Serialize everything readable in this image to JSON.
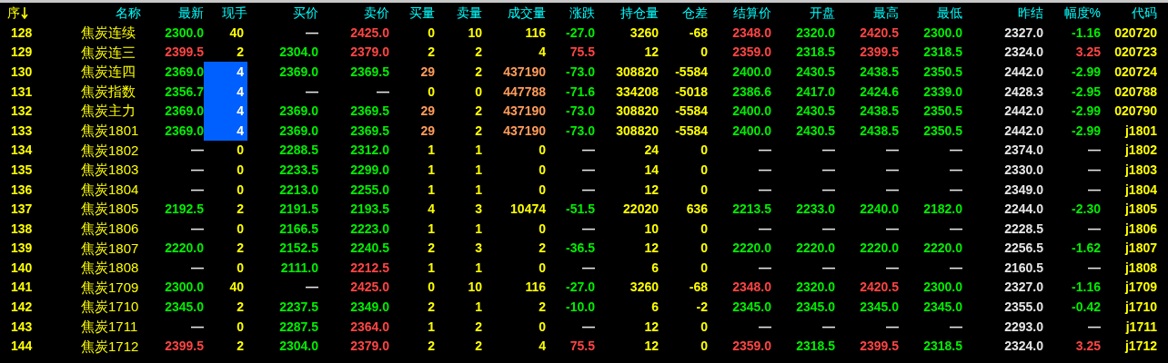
{
  "columns": [
    {
      "label": "序",
      "sort_descending": true
    },
    {
      "label": "名称"
    },
    {
      "label": "最新"
    },
    {
      "label": "现手"
    },
    {
      "label": "买价"
    },
    {
      "label": "卖价"
    },
    {
      "label": "买量"
    },
    {
      "label": "卖量"
    },
    {
      "label": "成交量"
    },
    {
      "label": "涨跌"
    },
    {
      "label": "持仓量"
    },
    {
      "label": "仓差"
    },
    {
      "label": "结算价"
    },
    {
      "label": "开盘"
    },
    {
      "label": "最高"
    },
    {
      "label": "最低"
    },
    {
      "label": "昨结"
    },
    {
      "label": "幅度%"
    },
    {
      "label": "代码"
    }
  ],
  "rows": [
    {
      "volume_highlighted": false,
      "cells": [
        {
          "text": "128",
          "color": "#ffff00"
        },
        {
          "text": "焦炭连续",
          "color": "#ffff00"
        },
        {
          "text": "2300.0",
          "color": "#00ee00"
        },
        {
          "text": "40",
          "color": "#ffff00"
        },
        {
          "text": "—",
          "color": "#e6e6e6"
        },
        {
          "text": "2425.0",
          "color": "#ff4444"
        },
        {
          "text": "0",
          "color": "#ffff00"
        },
        {
          "text": "10",
          "color": "#ffff00"
        },
        {
          "text": "116",
          "color": "#ffff00"
        },
        {
          "text": "-27.0",
          "color": "#00ee00"
        },
        {
          "text": "3260",
          "color": "#ffff00"
        },
        {
          "text": "-68",
          "color": "#ffff00"
        },
        {
          "text": "2348.0",
          "color": "#ff4444"
        },
        {
          "text": "2320.0",
          "color": "#00ee00"
        },
        {
          "text": "2420.5",
          "color": "#ff4444"
        },
        {
          "text": "2300.0",
          "color": "#00ee00"
        },
        {
          "text": "2327.0",
          "color": "#e6e6e6"
        },
        {
          "text": "-1.16",
          "color": "#00ee00"
        },
        {
          "text": "020720",
          "color": "#ffff00"
        }
      ]
    },
    {
      "volume_highlighted": false,
      "cells": [
        {
          "text": "129",
          "color": "#ffff00"
        },
        {
          "text": "焦炭连三",
          "color": "#ffff00"
        },
        {
          "text": "2399.5",
          "color": "#ff4444"
        },
        {
          "text": "2",
          "color": "#ffff00"
        },
        {
          "text": "2304.0",
          "color": "#00ee00"
        },
        {
          "text": "2379.0",
          "color": "#ff4444"
        },
        {
          "text": "2",
          "color": "#ffff00"
        },
        {
          "text": "2",
          "color": "#ffff00"
        },
        {
          "text": "4",
          "color": "#ffff00"
        },
        {
          "text": "75.5",
          "color": "#ff4444"
        },
        {
          "text": "12",
          "color": "#ffff00"
        },
        {
          "text": "0",
          "color": "#ffff00"
        },
        {
          "text": "2359.0",
          "color": "#ff4444"
        },
        {
          "text": "2318.5",
          "color": "#00ee00"
        },
        {
          "text": "2399.5",
          "color": "#ff4444"
        },
        {
          "text": "2318.5",
          "color": "#00ee00"
        },
        {
          "text": "2324.0",
          "color": "#e6e6e6"
        },
        {
          "text": "3.25",
          "color": "#ff4444"
        },
        {
          "text": "020723",
          "color": "#ffff00"
        }
      ]
    },
    {
      "volume_highlighted": true,
      "cells": [
        {
          "text": "130",
          "color": "#ffff00"
        },
        {
          "text": "焦炭连四",
          "color": "#ffff00"
        },
        {
          "text": "2369.0",
          "color": "#00ee00"
        },
        {
          "text": "4",
          "color": "#ffffff"
        },
        {
          "text": "2369.0",
          "color": "#00ee00"
        },
        {
          "text": "2369.5",
          "color": "#00ee00"
        },
        {
          "text": "29",
          "color": "#ff9c5a"
        },
        {
          "text": "2",
          "color": "#ffff00"
        },
        {
          "text": "437190",
          "color": "#ff9c5a"
        },
        {
          "text": "-73.0",
          "color": "#00ee00"
        },
        {
          "text": "308820",
          "color": "#ffff00"
        },
        {
          "text": "-5584",
          "color": "#ffff00"
        },
        {
          "text": "2400.0",
          "color": "#00ee00"
        },
        {
          "text": "2430.5",
          "color": "#00ee00"
        },
        {
          "text": "2438.5",
          "color": "#00ee00"
        },
        {
          "text": "2350.5",
          "color": "#00ee00"
        },
        {
          "text": "2442.0",
          "color": "#e6e6e6"
        },
        {
          "text": "-2.99",
          "color": "#00ee00"
        },
        {
          "text": "020724",
          "color": "#ffff00"
        }
      ]
    },
    {
      "volume_highlighted": true,
      "cells": [
        {
          "text": "131",
          "color": "#ffff00"
        },
        {
          "text": "焦炭指数",
          "color": "#ffff00"
        },
        {
          "text": "2356.7",
          "color": "#00ee00"
        },
        {
          "text": "4",
          "color": "#ffffff"
        },
        {
          "text": "—",
          "color": "#e6e6e6"
        },
        {
          "text": "—",
          "color": "#e6e6e6"
        },
        {
          "text": "0",
          "color": "#ffff00"
        },
        {
          "text": "0",
          "color": "#ffff00"
        },
        {
          "text": "447788",
          "color": "#ff9c5a"
        },
        {
          "text": "-71.6",
          "color": "#00ee00"
        },
        {
          "text": "334208",
          "color": "#ffff00"
        },
        {
          "text": "-5018",
          "color": "#ffff00"
        },
        {
          "text": "2386.6",
          "color": "#00ee00"
        },
        {
          "text": "2417.0",
          "color": "#00ee00"
        },
        {
          "text": "2424.6",
          "color": "#00ee00"
        },
        {
          "text": "2339.0",
          "color": "#00ee00"
        },
        {
          "text": "2428.3",
          "color": "#e6e6e6"
        },
        {
          "text": "-2.95",
          "color": "#00ee00"
        },
        {
          "text": "020788",
          "color": "#ffff00"
        }
      ]
    },
    {
      "volume_highlighted": true,
      "cells": [
        {
          "text": "132",
          "color": "#ffff00"
        },
        {
          "text": "焦炭主力",
          "color": "#ffff00"
        },
        {
          "text": "2369.0",
          "color": "#00ee00"
        },
        {
          "text": "4",
          "color": "#ffffff"
        },
        {
          "text": "2369.0",
          "color": "#00ee00"
        },
        {
          "text": "2369.5",
          "color": "#00ee00"
        },
        {
          "text": "29",
          "color": "#ff9c5a"
        },
        {
          "text": "2",
          "color": "#ffff00"
        },
        {
          "text": "437190",
          "color": "#ff9c5a"
        },
        {
          "text": "-73.0",
          "color": "#00ee00"
        },
        {
          "text": "308820",
          "color": "#ffff00"
        },
        {
          "text": "-5584",
          "color": "#ffff00"
        },
        {
          "text": "2400.0",
          "color": "#00ee00"
        },
        {
          "text": "2430.5",
          "color": "#00ee00"
        },
        {
          "text": "2438.5",
          "color": "#00ee00"
        },
        {
          "text": "2350.5",
          "color": "#00ee00"
        },
        {
          "text": "2442.0",
          "color": "#e6e6e6"
        },
        {
          "text": "-2.99",
          "color": "#00ee00"
        },
        {
          "text": "020790",
          "color": "#ffff00"
        }
      ]
    },
    {
      "volume_highlighted": true,
      "cells": [
        {
          "text": "133",
          "color": "#ffff00"
        },
        {
          "text": "焦炭1801",
          "color": "#ffff00"
        },
        {
          "text": "2369.0",
          "color": "#00ee00"
        },
        {
          "text": "4",
          "color": "#ffffff"
        },
        {
          "text": "2369.0",
          "color": "#00ee00"
        },
        {
          "text": "2369.5",
          "color": "#00ee00"
        },
        {
          "text": "29",
          "color": "#ff9c5a"
        },
        {
          "text": "2",
          "color": "#ffff00"
        },
        {
          "text": "437190",
          "color": "#ff9c5a"
        },
        {
          "text": "-73.0",
          "color": "#00ee00"
        },
        {
          "text": "308820",
          "color": "#ffff00"
        },
        {
          "text": "-5584",
          "color": "#ffff00"
        },
        {
          "text": "2400.0",
          "color": "#00ee00"
        },
        {
          "text": "2430.5",
          "color": "#00ee00"
        },
        {
          "text": "2438.5",
          "color": "#00ee00"
        },
        {
          "text": "2350.5",
          "color": "#00ee00"
        },
        {
          "text": "2442.0",
          "color": "#e6e6e6"
        },
        {
          "text": "-2.99",
          "color": "#00ee00"
        },
        {
          "text": "j1801",
          "color": "#ffff00"
        }
      ]
    },
    {
      "volume_highlighted": false,
      "cells": [
        {
          "text": "134",
          "color": "#ffff00"
        },
        {
          "text": "焦炭1802",
          "color": "#ffff00"
        },
        {
          "text": "—",
          "color": "#e6e6e6"
        },
        {
          "text": "0",
          "color": "#ffff00"
        },
        {
          "text": "2288.5",
          "color": "#00ee00"
        },
        {
          "text": "2312.0",
          "color": "#00ee00"
        },
        {
          "text": "1",
          "color": "#ffff00"
        },
        {
          "text": "1",
          "color": "#ffff00"
        },
        {
          "text": "0",
          "color": "#ffff00"
        },
        {
          "text": "—",
          "color": "#e6e6e6"
        },
        {
          "text": "24",
          "color": "#ffff00"
        },
        {
          "text": "0",
          "color": "#ffff00"
        },
        {
          "text": "—",
          "color": "#e6e6e6"
        },
        {
          "text": "—",
          "color": "#e6e6e6"
        },
        {
          "text": "—",
          "color": "#e6e6e6"
        },
        {
          "text": "—",
          "color": "#e6e6e6"
        },
        {
          "text": "2374.0",
          "color": "#e6e6e6"
        },
        {
          "text": "—",
          "color": "#e6e6e6"
        },
        {
          "text": "j1802",
          "color": "#ffff00"
        }
      ]
    },
    {
      "volume_highlighted": false,
      "cells": [
        {
          "text": "135",
          "color": "#ffff00"
        },
        {
          "text": "焦炭1803",
          "color": "#ffff00"
        },
        {
          "text": "—",
          "color": "#e6e6e6"
        },
        {
          "text": "0",
          "color": "#ffff00"
        },
        {
          "text": "2233.5",
          "color": "#00ee00"
        },
        {
          "text": "2299.0",
          "color": "#00ee00"
        },
        {
          "text": "1",
          "color": "#ffff00"
        },
        {
          "text": "1",
          "color": "#ffff00"
        },
        {
          "text": "0",
          "color": "#ffff00"
        },
        {
          "text": "—",
          "color": "#e6e6e6"
        },
        {
          "text": "14",
          "color": "#ffff00"
        },
        {
          "text": "0",
          "color": "#ffff00"
        },
        {
          "text": "—",
          "color": "#e6e6e6"
        },
        {
          "text": "—",
          "color": "#e6e6e6"
        },
        {
          "text": "—",
          "color": "#e6e6e6"
        },
        {
          "text": "—",
          "color": "#e6e6e6"
        },
        {
          "text": "2330.0",
          "color": "#e6e6e6"
        },
        {
          "text": "—",
          "color": "#e6e6e6"
        },
        {
          "text": "j1803",
          "color": "#ffff00"
        }
      ]
    },
    {
      "volume_highlighted": false,
      "cells": [
        {
          "text": "136",
          "color": "#ffff00"
        },
        {
          "text": "焦炭1804",
          "color": "#ffff00"
        },
        {
          "text": "—",
          "color": "#e6e6e6"
        },
        {
          "text": "0",
          "color": "#ffff00"
        },
        {
          "text": "2213.0",
          "color": "#00ee00"
        },
        {
          "text": "2255.0",
          "color": "#00ee00"
        },
        {
          "text": "1",
          "color": "#ffff00"
        },
        {
          "text": "1",
          "color": "#ffff00"
        },
        {
          "text": "0",
          "color": "#ffff00"
        },
        {
          "text": "—",
          "color": "#e6e6e6"
        },
        {
          "text": "12",
          "color": "#ffff00"
        },
        {
          "text": "0",
          "color": "#ffff00"
        },
        {
          "text": "—",
          "color": "#e6e6e6"
        },
        {
          "text": "—",
          "color": "#e6e6e6"
        },
        {
          "text": "—",
          "color": "#e6e6e6"
        },
        {
          "text": "—",
          "color": "#e6e6e6"
        },
        {
          "text": "2349.0",
          "color": "#e6e6e6"
        },
        {
          "text": "—",
          "color": "#e6e6e6"
        },
        {
          "text": "j1804",
          "color": "#ffff00"
        }
      ]
    },
    {
      "volume_highlighted": false,
      "cells": [
        {
          "text": "137",
          "color": "#ffff00"
        },
        {
          "text": "焦炭1805",
          "color": "#ffff00"
        },
        {
          "text": "2192.5",
          "color": "#00ee00"
        },
        {
          "text": "2",
          "color": "#ffff00"
        },
        {
          "text": "2191.5",
          "color": "#00ee00"
        },
        {
          "text": "2193.5",
          "color": "#00ee00"
        },
        {
          "text": "4",
          "color": "#ffff00"
        },
        {
          "text": "3",
          "color": "#ffff00"
        },
        {
          "text": "10474",
          "color": "#ffff00"
        },
        {
          "text": "-51.5",
          "color": "#00ee00"
        },
        {
          "text": "22020",
          "color": "#ffff00"
        },
        {
          "text": "636",
          "color": "#ffff00"
        },
        {
          "text": "2213.5",
          "color": "#00ee00"
        },
        {
          "text": "2233.0",
          "color": "#00ee00"
        },
        {
          "text": "2240.0",
          "color": "#00ee00"
        },
        {
          "text": "2182.0",
          "color": "#00ee00"
        },
        {
          "text": "2244.0",
          "color": "#e6e6e6"
        },
        {
          "text": "-2.30",
          "color": "#00ee00"
        },
        {
          "text": "j1805",
          "color": "#ffff00"
        }
      ]
    },
    {
      "volume_highlighted": false,
      "cells": [
        {
          "text": "138",
          "color": "#ffff00"
        },
        {
          "text": "焦炭1806",
          "color": "#ffff00"
        },
        {
          "text": "—",
          "color": "#e6e6e6"
        },
        {
          "text": "0",
          "color": "#ffff00"
        },
        {
          "text": "2166.5",
          "color": "#00ee00"
        },
        {
          "text": "2223.0",
          "color": "#00ee00"
        },
        {
          "text": "1",
          "color": "#ffff00"
        },
        {
          "text": "1",
          "color": "#ffff00"
        },
        {
          "text": "0",
          "color": "#ffff00"
        },
        {
          "text": "—",
          "color": "#e6e6e6"
        },
        {
          "text": "10",
          "color": "#ffff00"
        },
        {
          "text": "0",
          "color": "#ffff00"
        },
        {
          "text": "—",
          "color": "#e6e6e6"
        },
        {
          "text": "—",
          "color": "#e6e6e6"
        },
        {
          "text": "—",
          "color": "#e6e6e6"
        },
        {
          "text": "—",
          "color": "#e6e6e6"
        },
        {
          "text": "2228.5",
          "color": "#e6e6e6"
        },
        {
          "text": "—",
          "color": "#e6e6e6"
        },
        {
          "text": "j1806",
          "color": "#ffff00"
        }
      ]
    },
    {
      "volume_highlighted": false,
      "cells": [
        {
          "text": "139",
          "color": "#ffff00"
        },
        {
          "text": "焦炭1807",
          "color": "#ffff00"
        },
        {
          "text": "2220.0",
          "color": "#00ee00"
        },
        {
          "text": "2",
          "color": "#ffff00"
        },
        {
          "text": "2152.5",
          "color": "#00ee00"
        },
        {
          "text": "2240.5",
          "color": "#00ee00"
        },
        {
          "text": "2",
          "color": "#ffff00"
        },
        {
          "text": "3",
          "color": "#ffff00"
        },
        {
          "text": "2",
          "color": "#ffff00"
        },
        {
          "text": "-36.5",
          "color": "#00ee00"
        },
        {
          "text": "12",
          "color": "#ffff00"
        },
        {
          "text": "0",
          "color": "#ffff00"
        },
        {
          "text": "2220.0",
          "color": "#00ee00"
        },
        {
          "text": "2220.0",
          "color": "#00ee00"
        },
        {
          "text": "2220.0",
          "color": "#00ee00"
        },
        {
          "text": "2220.0",
          "color": "#00ee00"
        },
        {
          "text": "2256.5",
          "color": "#e6e6e6"
        },
        {
          "text": "-1.62",
          "color": "#00ee00"
        },
        {
          "text": "j1807",
          "color": "#ffff00"
        }
      ]
    },
    {
      "volume_highlighted": false,
      "cells": [
        {
          "text": "140",
          "color": "#ffff00"
        },
        {
          "text": "焦炭1808",
          "color": "#ffff00"
        },
        {
          "text": "—",
          "color": "#e6e6e6"
        },
        {
          "text": "0",
          "color": "#ffff00"
        },
        {
          "text": "2111.0",
          "color": "#00ee00"
        },
        {
          "text": "2212.5",
          "color": "#ff4444"
        },
        {
          "text": "1",
          "color": "#ffff00"
        },
        {
          "text": "1",
          "color": "#ffff00"
        },
        {
          "text": "0",
          "color": "#ffff00"
        },
        {
          "text": "—",
          "color": "#e6e6e6"
        },
        {
          "text": "6",
          "color": "#ffff00"
        },
        {
          "text": "0",
          "color": "#ffff00"
        },
        {
          "text": "—",
          "color": "#e6e6e6"
        },
        {
          "text": "—",
          "color": "#e6e6e6"
        },
        {
          "text": "—",
          "color": "#e6e6e6"
        },
        {
          "text": "—",
          "color": "#e6e6e6"
        },
        {
          "text": "2160.5",
          "color": "#e6e6e6"
        },
        {
          "text": "—",
          "color": "#e6e6e6"
        },
        {
          "text": "j1808",
          "color": "#ffff00"
        }
      ]
    },
    {
      "volume_highlighted": false,
      "cells": [
        {
          "text": "141",
          "color": "#ffff00"
        },
        {
          "text": "焦炭1709",
          "color": "#ffff00"
        },
        {
          "text": "2300.0",
          "color": "#00ee00"
        },
        {
          "text": "40",
          "color": "#ffff00"
        },
        {
          "text": "—",
          "color": "#e6e6e6"
        },
        {
          "text": "2425.0",
          "color": "#ff4444"
        },
        {
          "text": "0",
          "color": "#ffff00"
        },
        {
          "text": "10",
          "color": "#ffff00"
        },
        {
          "text": "116",
          "color": "#ffff00"
        },
        {
          "text": "-27.0",
          "color": "#00ee00"
        },
        {
          "text": "3260",
          "color": "#ffff00"
        },
        {
          "text": "-68",
          "color": "#ffff00"
        },
        {
          "text": "2348.0",
          "color": "#ff4444"
        },
        {
          "text": "2320.0",
          "color": "#00ee00"
        },
        {
          "text": "2420.5",
          "color": "#ff4444"
        },
        {
          "text": "2300.0",
          "color": "#00ee00"
        },
        {
          "text": "2327.0",
          "color": "#e6e6e6"
        },
        {
          "text": "-1.16",
          "color": "#00ee00"
        },
        {
          "text": "j1709",
          "color": "#ffff00"
        }
      ]
    },
    {
      "volume_highlighted": false,
      "cells": [
        {
          "text": "142",
          "color": "#ffff00"
        },
        {
          "text": "焦炭1710",
          "color": "#ffff00"
        },
        {
          "text": "2345.0",
          "color": "#00ee00"
        },
        {
          "text": "2",
          "color": "#ffff00"
        },
        {
          "text": "2237.5",
          "color": "#00ee00"
        },
        {
          "text": "2349.0",
          "color": "#00ee00"
        },
        {
          "text": "2",
          "color": "#ffff00"
        },
        {
          "text": "1",
          "color": "#ffff00"
        },
        {
          "text": "2",
          "color": "#ffff00"
        },
        {
          "text": "-10.0",
          "color": "#00ee00"
        },
        {
          "text": "6",
          "color": "#ffff00"
        },
        {
          "text": "-2",
          "color": "#ffff00"
        },
        {
          "text": "2345.0",
          "color": "#00ee00"
        },
        {
          "text": "2345.0",
          "color": "#00ee00"
        },
        {
          "text": "2345.0",
          "color": "#00ee00"
        },
        {
          "text": "2345.0",
          "color": "#00ee00"
        },
        {
          "text": "2355.0",
          "color": "#e6e6e6"
        },
        {
          "text": "-0.42",
          "color": "#00ee00"
        },
        {
          "text": "j1710",
          "color": "#ffff00"
        }
      ]
    },
    {
      "volume_highlighted": false,
      "cells": [
        {
          "text": "143",
          "color": "#ffff00"
        },
        {
          "text": "焦炭1711",
          "color": "#ffff00"
        },
        {
          "text": "—",
          "color": "#e6e6e6"
        },
        {
          "text": "0",
          "color": "#ffff00"
        },
        {
          "text": "2287.5",
          "color": "#00ee00"
        },
        {
          "text": "2364.0",
          "color": "#ff4444"
        },
        {
          "text": "1",
          "color": "#ffff00"
        },
        {
          "text": "2",
          "color": "#ffff00"
        },
        {
          "text": "0",
          "color": "#ffff00"
        },
        {
          "text": "—",
          "color": "#e6e6e6"
        },
        {
          "text": "12",
          "color": "#ffff00"
        },
        {
          "text": "0",
          "color": "#ffff00"
        },
        {
          "text": "—",
          "color": "#e6e6e6"
        },
        {
          "text": "—",
          "color": "#e6e6e6"
        },
        {
          "text": "—",
          "color": "#e6e6e6"
        },
        {
          "text": "—",
          "color": "#e6e6e6"
        },
        {
          "text": "2293.0",
          "color": "#e6e6e6"
        },
        {
          "text": "—",
          "color": "#e6e6e6"
        },
        {
          "text": "j1711",
          "color": "#ffff00"
        }
      ]
    },
    {
      "volume_highlighted": false,
      "cells": [
        {
          "text": "144",
          "color": "#ffff00"
        },
        {
          "text": "焦炭1712",
          "color": "#ffff00"
        },
        {
          "text": "2399.5",
          "color": "#ff4444"
        },
        {
          "text": "2",
          "color": "#ffff00"
        },
        {
          "text": "2304.0",
          "color": "#00ee00"
        },
        {
          "text": "2379.0",
          "color": "#ff4444"
        },
        {
          "text": "2",
          "color": "#ffff00"
        },
        {
          "text": "2",
          "color": "#ffff00"
        },
        {
          "text": "4",
          "color": "#ffff00"
        },
        {
          "text": "75.5",
          "color": "#ff4444"
        },
        {
          "text": "12",
          "color": "#ffff00"
        },
        {
          "text": "0",
          "color": "#ffff00"
        },
        {
          "text": "2359.0",
          "color": "#ff4444"
        },
        {
          "text": "2318.5",
          "color": "#00ee00"
        },
        {
          "text": "2399.5",
          "color": "#ff4444"
        },
        {
          "text": "2318.5",
          "color": "#00ee00"
        },
        {
          "text": "2324.0",
          "color": "#e6e6e6"
        },
        {
          "text": "3.25",
          "color": "#ff4444"
        },
        {
          "text": "j1712",
          "color": "#ffff00"
        }
      ]
    }
  ]
}
